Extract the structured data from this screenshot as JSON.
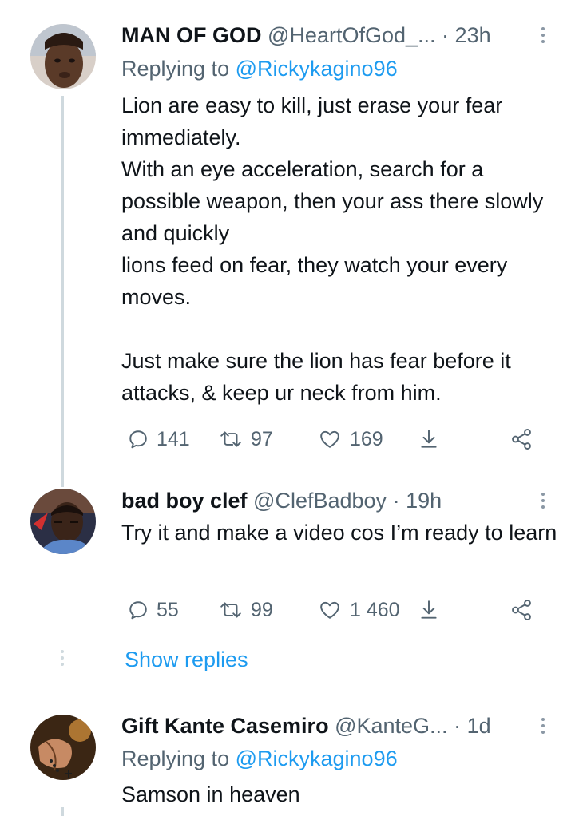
{
  "tweets": [
    {
      "name": "MAN OF GOD",
      "handle": "@HeartOfGod_...",
      "dot": "·",
      "time": "23h",
      "replying_prefix": "Replying to",
      "replying_to": "@Rickykagino96",
      "text_lines": [
        "Lion are easy to kill, just erase your fear immediately.",
        "With an eye acceleration, search for a possible weapon, then your ass there slowly and quickly",
        "lions feed on fear, they watch your every moves.",
        "",
        "Just make sure the lion has fear before it attacks, & keep ur neck from him."
      ],
      "replies": "141",
      "retweets": "97",
      "likes": "169"
    },
    {
      "name": "bad boy clef",
      "handle": "@ClefBadboy",
      "dot": "·",
      "time": "19h",
      "text_lines": [
        "Try it and make a video cos I’m ready to learn"
      ],
      "replies": "55",
      "retweets": "99",
      "likes": "1 460"
    },
    {
      "name": "Gift Kante Casemiro",
      "handle": "@KanteG...",
      "dot": "·",
      "time": "1d",
      "replying_prefix": "Replying to",
      "replying_to": "@Rickykagino96",
      "text_lines": [
        "Samson in heaven"
      ]
    }
  ],
  "show_replies": "Show replies",
  "colors": {
    "accent": "#1d9bf0",
    "secondary": "#536471",
    "text": "#0f1419"
  },
  "icons": [
    "reply-icon",
    "retweet-icon",
    "like-icon",
    "share-icon",
    "share-network-icon",
    "more-icon"
  ]
}
